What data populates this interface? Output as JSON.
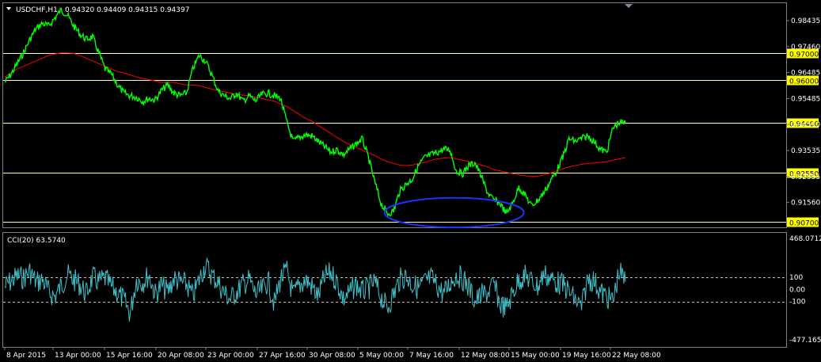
{
  "header": {
    "symbol": "USDCHF,H1",
    "ohlc": "0.94320 0.94409 0.94315 0.94397"
  },
  "colors": {
    "background": "#000000",
    "price": "#00ff00",
    "ma": "#ff0000",
    "level_lines": "#ffff99",
    "level_label_bg": "#ffff00",
    "cci": "#40c0c8",
    "annotation": "#1a33ff",
    "axis_text": "#ffffff"
  },
  "chart_data": [
    {
      "type": "line",
      "panel": "price",
      "series": [
        {
          "values": [
            0.959,
            0.962,
            0.966,
            0.97,
            0.975,
            0.979,
            0.981,
            0.98,
            0.983,
            0.986,
            0.984,
            0.98,
            0.977,
            0.975,
            0.976,
            0.97,
            0.964,
            0.962,
            0.958,
            0.955,
            0.954,
            0.9535,
            0.952,
            0.953,
            0.9525,
            0.956,
            0.958,
            0.955,
            0.954,
            0.955,
            0.964,
            0.969,
            0.967,
            0.962,
            0.956,
            0.954,
            0.953,
            0.955,
            0.952,
            0.954,
            0.952,
            0.9545,
            0.955,
            0.954,
            0.953,
            0.944,
            0.937,
            0.9385,
            0.9395,
            0.939,
            0.937,
            0.935,
            0.933,
            0.934,
            0.932,
            0.934,
            0.936,
            0.938,
            0.931,
            0.922,
            0.914,
            0.91,
            0.911,
            0.9185,
            0.921,
            0.923,
            0.928,
            0.931,
            0.932,
            0.933,
            0.934,
            0.934,
            0.926,
            0.925,
            0.928,
            0.929,
            0.924,
            0.918,
            0.915,
            0.914,
            0.91,
            0.914,
            0.92,
            0.917,
            0.913,
            0.915,
            0.918,
            0.922,
            0.926,
            0.931,
            0.938,
            0.937,
            0.938,
            0.939,
            0.937,
            0.934,
            0.933,
            0.942,
            0.944,
            0.9438
          ]
        },
        {
          "values": [
            0.961,
            0.9625,
            0.964,
            0.965,
            0.966,
            0.967,
            0.968,
            0.969,
            0.9696,
            0.97,
            0.97,
            0.9698,
            0.969,
            0.968,
            0.967,
            0.966,
            0.965,
            0.964,
            0.963,
            0.9625,
            0.9618,
            0.961,
            0.9605,
            0.96,
            0.9595,
            0.959,
            0.959,
            0.959,
            0.9585,
            0.958,
            0.958,
            0.9578,
            0.9572,
            0.9565,
            0.956,
            0.9555,
            0.955,
            0.9546,
            0.9542,
            0.954,
            0.9535,
            0.953,
            0.9525,
            0.952,
            0.951,
            0.95,
            0.9485,
            0.947,
            0.9455,
            0.9445,
            0.943,
            0.9415,
            0.94,
            0.9385,
            0.937,
            0.9358,
            0.9348,
            0.9338,
            0.9328,
            0.9318,
            0.9305,
            0.9295,
            0.9288,
            0.9282,
            0.928,
            0.9282,
            0.9288,
            0.9292,
            0.93,
            0.9305,
            0.9308,
            0.931,
            0.9305,
            0.93,
            0.9295,
            0.929,
            0.9282,
            0.9275,
            0.9265,
            0.926,
            0.9255,
            0.925,
            0.9245,
            0.9242,
            0.924,
            0.924,
            0.9245,
            0.9252,
            0.926,
            0.9268,
            0.9275,
            0.928,
            0.9285,
            0.9288,
            0.929,
            0.9292,
            0.9295,
            0.93,
            0.9305,
            0.931
          ]
        }
      ],
      "ylim": [
        0.905,
        0.9885
      ],
      "price_ticks": [
        "0.98435",
        "0.97460",
        "0.96485",
        "0.95485",
        "0.94510",
        "0.93535",
        "0.92555",
        "0.91560"
      ],
      "levels": [
        "0.97000",
        "0.96000",
        "0.94400",
        "0.92550",
        "0.90700"
      ],
      "level_values": [
        0.97,
        0.96,
        0.944,
        0.9255,
        0.907
      ],
      "annotation": {
        "shape": "ellipse",
        "x_from": 0.487,
        "x_to": 0.665,
        "y_from": 0.905,
        "y_to": 0.916
      }
    },
    {
      "type": "line",
      "panel": "indicator",
      "label": "CCI(20) 63.5740",
      "ylim": [
        -477.1659,
        468.0712
      ],
      "scale_max": "468.0712",
      "scale_min": "-477.1659",
      "levels": [
        "100",
        "0.00",
        "-100"
      ],
      "level_values": [
        100,
        0,
        -100
      ],
      "series": [
        {
          "values": [
            20,
            70,
            110,
            95,
            150,
            60,
            80,
            -20,
            -60,
            30,
            120,
            80,
            40,
            -40,
            100,
            60,
            90,
            20,
            -30,
            -90,
            -200,
            80,
            60,
            120,
            -40,
            30,
            -20,
            90,
            60,
            40,
            -60,
            80,
            200,
            120,
            60,
            -30,
            -80,
            -20,
            40,
            80,
            -40,
            -10,
            70,
            -120,
            90,
            150,
            -50,
            30,
            80,
            20,
            -60,
            100,
            140,
            60,
            -80,
            -30,
            40,
            -20,
            10,
            60,
            -60,
            -160,
            -40,
            80,
            110,
            40,
            10,
            60,
            90,
            30,
            -40,
            50,
            120,
            90,
            20,
            -100,
            -50,
            -30,
            40,
            -120,
            -160,
            -30,
            80,
            110,
            70,
            20,
            130,
            90,
            60,
            40,
            -20,
            -90,
            -150,
            90,
            70,
            -20,
            -60,
            -100,
            150,
            63
          ]
        }
      ]
    }
  ],
  "x_axis": {
    "labels": [
      "8 Apr 2015",
      "13 Apr 00:00",
      "15 Apr 16:00",
      "20 Apr 08:00",
      "23 Apr 00:00",
      "27 Apr 16:00",
      "30 Apr 08:00",
      "5 May 00:00",
      "7 May 16:00",
      "12 May 08:00",
      "15 May 00:00",
      "19 May 16:00",
      "22 May 08:00"
    ]
  }
}
